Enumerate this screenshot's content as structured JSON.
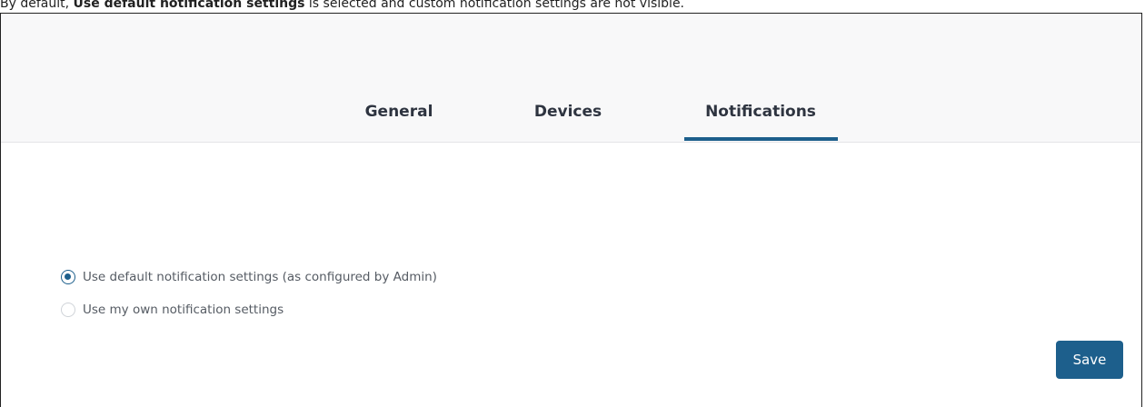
{
  "caption": {
    "prefix": "By default, ",
    "bold": "Use default notification settings",
    "suffix": " is selected and custom notification settings are not visible."
  },
  "tabs": [
    {
      "label": "General",
      "active": false
    },
    {
      "label": "Devices",
      "active": false
    },
    {
      "label": "Notifications",
      "active": true
    }
  ],
  "notification_options": [
    {
      "label": "Use default notification settings (as configured by Admin)",
      "selected": true
    },
    {
      "label": "Use my own notification settings",
      "selected": false
    }
  ],
  "save_label": "Save",
  "colors": {
    "accent": "#1d5f8c",
    "header_bg": "#f8f8f9",
    "tab_text": "#2e3440",
    "option_text": "#555b63"
  }
}
